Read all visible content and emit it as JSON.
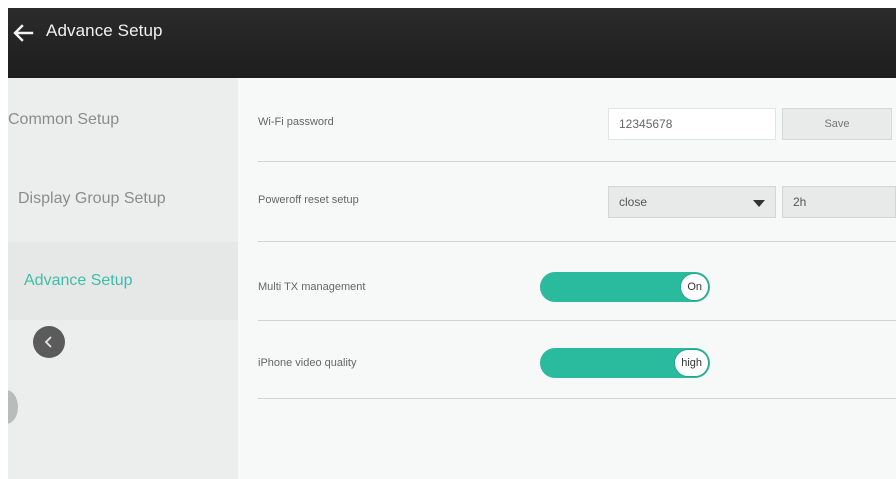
{
  "header": {
    "title": "Advance Setup",
    "back_icon": "arrow-left-icon"
  },
  "sidebar": {
    "items": [
      {
        "label": "Common Setup",
        "active": false
      },
      {
        "label": "Display Group Setup",
        "active": false
      },
      {
        "label": "Advance Setup",
        "active": true
      }
    ],
    "collapse_icon": "chevron-left-icon"
  },
  "settings": {
    "wifi": {
      "label": "Wi-Fi password",
      "value": "12345678",
      "save_label": "Save"
    },
    "poweroff": {
      "label": "Poweroff reset setup",
      "mode": "close",
      "duration": "2h"
    },
    "multi_tx": {
      "label": "Multi TX management",
      "state": "On"
    },
    "iphone_quality": {
      "label": "iPhone video quality",
      "state": "high"
    }
  },
  "colors": {
    "accent": "#2aba9e",
    "active_text": "#3cbfa9",
    "header_bg": "#222222"
  }
}
